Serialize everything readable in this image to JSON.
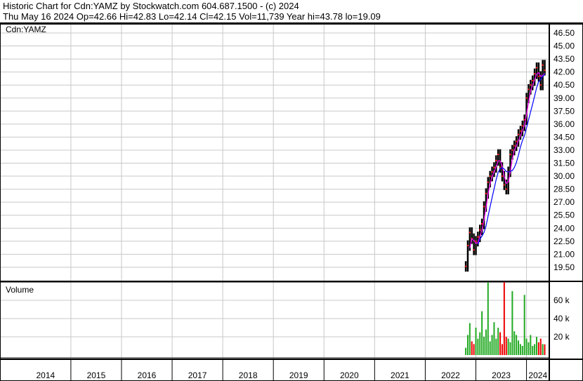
{
  "header": {
    "title": "Historic Chart for Cdn:YAMZ by Stockwatch.com 604.687.1500 - (c) 2024",
    "quote": "Thu May 16 2024   Op=42.66  Hi=42.83  Lo=42.14  Cl=42.15  Vol=11,739   Year hi=43.78  lo=19.09"
  },
  "chart_data": {
    "type": "bar",
    "symbol_label": "Cdn:YAMZ",
    "volume_label": "Volume",
    "price_ticks": [
      "46.50",
      "45.00",
      "43.50",
      "42.00",
      "40.50",
      "39.00",
      "37.50",
      "36.00",
      "34.50",
      "33.00",
      "31.50",
      "30.00",
      "28.50",
      "27.00",
      "25.50",
      "24.00",
      "22.50",
      "21.00",
      "19.50"
    ],
    "ylim": [
      18.5,
      47.5
    ],
    "volume_ticks": [
      "60 k",
      "40 k",
      "20 k"
    ],
    "volume_tick_values": [
      60000,
      40000,
      20000
    ],
    "years": [
      "2014",
      "2015",
      "2016",
      "2017",
      "2018",
      "2019",
      "2020",
      "2021",
      "2022",
      "2023",
      "2024"
    ],
    "xlim": [
      2013.6,
      2024.45
    ],
    "t": [
      2022.8,
      2022.84,
      2022.88,
      2022.92,
      2022.96,
      2023.0,
      2023.04,
      2023.08,
      2023.12,
      2023.16,
      2023.2,
      2023.24,
      2023.28,
      2023.32,
      2023.36,
      2023.4,
      2023.44,
      2023.48,
      2023.52,
      2023.56,
      2023.6,
      2023.64,
      2023.68,
      2023.72,
      2023.76,
      2023.8,
      2023.84,
      2023.88,
      2023.92,
      2023.96,
      2024.0,
      2024.04,
      2024.08,
      2024.12,
      2024.16,
      2024.2,
      2024.24,
      2024.28,
      2024.32,
      2024.36
    ],
    "close": [
      19.6,
      22.0,
      23.5,
      22.8,
      21.5,
      22.5,
      23.0,
      23.8,
      24.5,
      26.5,
      28.0,
      29.3,
      30.0,
      30.5,
      31.0,
      31.8,
      32.5,
      31.0,
      30.0,
      29.0,
      28.5,
      30.5,
      32.5,
      33.0,
      33.5,
      34.0,
      34.8,
      35.2,
      35.8,
      36.5,
      39.0,
      40.0,
      40.5,
      41.0,
      41.8,
      42.5,
      41.5,
      40.5,
      42.8,
      42.2
    ],
    "volume": [
      8000,
      22000,
      35000,
      15000,
      12000,
      30000,
      18000,
      25000,
      48000,
      20000,
      28000,
      80000,
      15000,
      22000,
      36000,
      18000,
      30000,
      25000,
      12000,
      80000,
      20000,
      18000,
      14000,
      70000,
      26000,
      22000,
      16000,
      12000,
      10000,
      66000,
      18000,
      14000,
      22000,
      10000,
      12000,
      20000,
      14000,
      18000,
      12000,
      11739
    ]
  }
}
